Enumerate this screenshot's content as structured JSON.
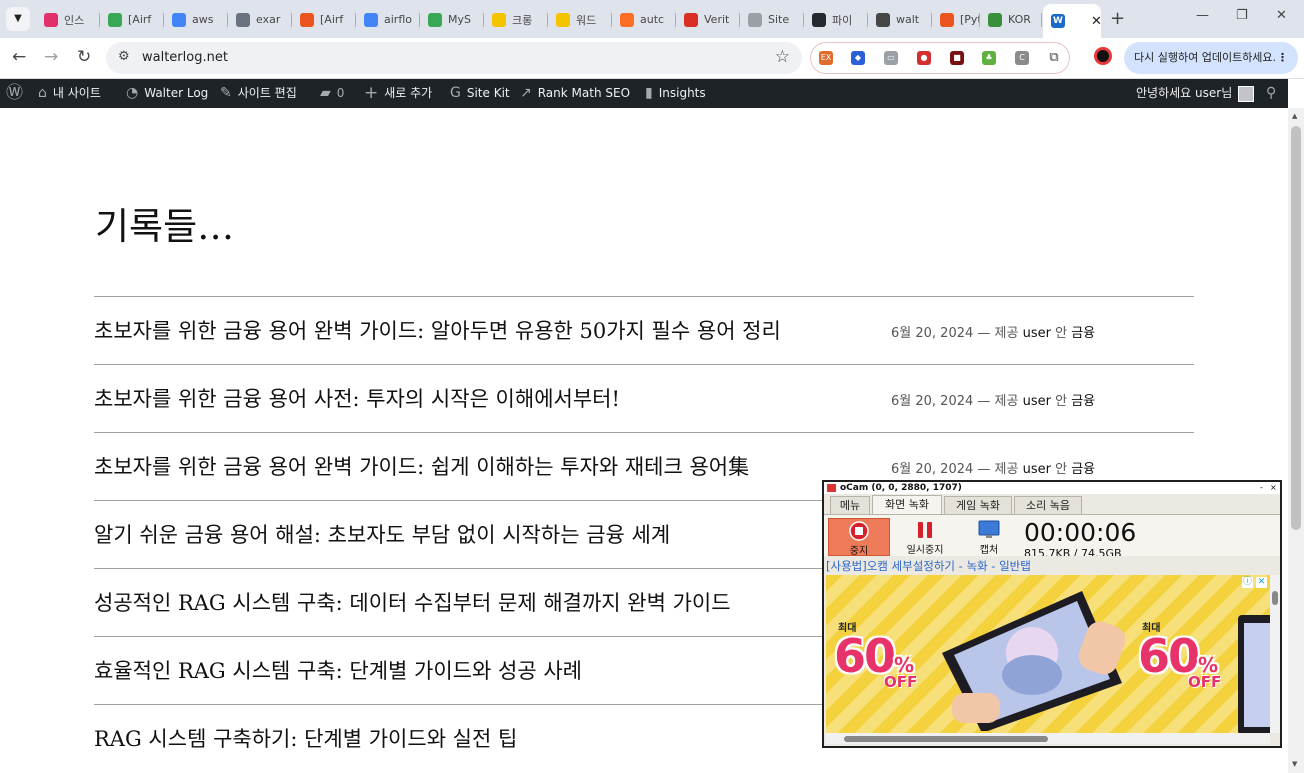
{
  "browser": {
    "tabs": [
      {
        "title": "인스",
        "favicon": "instagram-icon",
        "color": "#e1306c"
      },
      {
        "title": "[Airf",
        "favicon": "v-icon",
        "color": "#3aa757"
      },
      {
        "title": "aws",
        "favicon": "google-icon",
        "color": "#4285f4"
      },
      {
        "title": "exar",
        "favicon": "globe-icon",
        "color": "#6b7280"
      },
      {
        "title": "[Airf",
        "favicon": "tistory-icon",
        "color": "#eb531f"
      },
      {
        "title": "airflo",
        "favicon": "google-icon",
        "color": "#4285f4"
      },
      {
        "title": "MyS",
        "favicon": "v-icon",
        "color": "#3aa757"
      },
      {
        "title": "크롱",
        "favicon": "smile-icon",
        "color": "#f5c400"
      },
      {
        "title": "워드",
        "favicon": "smile-icon",
        "color": "#f5c400"
      },
      {
        "title": "autc",
        "favicon": "gitlab-icon",
        "color": "#fc6d26"
      },
      {
        "title": "Verit",
        "favicon": "gmail-icon",
        "color": "#d93025"
      },
      {
        "title": "Site",
        "favicon": "globe-icon",
        "color": "#9aa0a6"
      },
      {
        "title": "파이",
        "favicon": "github-icon",
        "color": "#24292f"
      },
      {
        "title": "walt",
        "favicon": "wordpress-icon",
        "color": "#464646"
      },
      {
        "title": "[Pyt",
        "favicon": "tistory-icon",
        "color": "#eb531f"
      },
      {
        "title": "KOR",
        "favicon": "leaf-icon",
        "color": "#3a8f3a"
      }
    ],
    "active_tab_favicon": "wordpress-icon",
    "url": "walterlog.net",
    "update_button": "다시 실행하여 업데이트하세요."
  },
  "adminbar": {
    "my_site": "내 사이트",
    "site_name": "Walter Log",
    "edit_site": "사이트 편집",
    "comments_count": "0",
    "new": "새로 추가",
    "site_kit": "Site Kit",
    "rank_math": "Rank Math SEO",
    "insights": "Insights",
    "greeting": "안녕하세요 user님"
  },
  "page": {
    "title": "기록들…",
    "posts": [
      {
        "title": "초보자를 위한 금융 용어 완벽 가이드: 알아두면 유용한 50가지 필수 용어 정리",
        "date": "6월 20, 2024",
        "by": "— 제공",
        "author": "user",
        "in": "안",
        "category": "금융"
      },
      {
        "title": "초보자를 위한 금융 용어 사전: 투자의 시작은 이해에서부터!",
        "date": "6월 20, 2024",
        "by": "— 제공",
        "author": "user",
        "in": "안",
        "category": "금융"
      },
      {
        "title": "초보자를 위한 금융 용어 완벽 가이드: 쉽게 이해하는 투자와 재테크 용어集",
        "date": "6월 20, 2024",
        "by": "— 제공",
        "author": "user",
        "in": "안",
        "category": "금융"
      },
      {
        "title": "알기 쉬운 금융 용어 해설: 초보자도 부담 없이 시작하는 금융 세계"
      },
      {
        "title": "성공적인 RAG 시스템 구축: 데이터 수집부터 문제 해결까지 완벽 가이드"
      },
      {
        "title": "효율적인 RAG 시스템 구축: 단계별 가이드와 성공 사례"
      },
      {
        "title": "RAG 시스템 구축하기: 단계별 가이드와 실전 팁"
      }
    ]
  },
  "ocam": {
    "title": "oCam (0, 0, 2880, 1707)",
    "tabs": [
      "메뉴",
      "화면 녹화",
      "게임 녹화",
      "소리 녹음"
    ],
    "selected_tab": "화면 녹화",
    "buttons": {
      "stop": "중지",
      "pause": "일시중지",
      "capture": "캡처"
    },
    "timer": "00:00:06",
    "size_info": "815.7KB / 74.5GB",
    "link": "[사용법]오캠 세부설정하기 - 녹화 - 일반탭",
    "ad": {
      "label": "최대",
      "percent": "60",
      "percent_sign": "%",
      "off": "OFF"
    }
  }
}
